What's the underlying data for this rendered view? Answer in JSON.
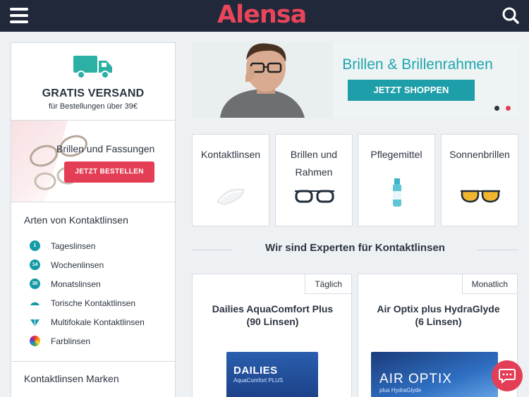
{
  "header": {
    "logo_text": "Alensa",
    "menu_icon": "hamburger-menu-icon",
    "search_icon": "search-icon",
    "bg_color": "#20283a",
    "logo_color": "#e8455a"
  },
  "sidebar": {
    "shipping": {
      "icon": "delivery-truck-icon",
      "title": "GRATIS VERSAND",
      "subtitle": "für Bestellungen über 39€"
    },
    "promo": {
      "title": "Brillen und Fassungen",
      "button_label": "JETZT BESTELLEN"
    },
    "types_title": "Arten von Kontaktlinsen",
    "types": [
      {
        "label": "Tageslinsen",
        "icon_text": "1"
      },
      {
        "label": "Wochenlinsen",
        "icon_text": "14"
      },
      {
        "label": "Monatslinsen",
        "icon_text": "30"
      },
      {
        "label": "Torische Kontaktlinsen",
        "icon_text": ""
      },
      {
        "label": "Multifokale Kontaktlinsen",
        "icon_text": ""
      },
      {
        "label": "Farblinsen",
        "icon_text": ""
      }
    ],
    "brands_title": "Kontaktlinsen Marken"
  },
  "banner": {
    "title": "Brillen & Brillenrahmen",
    "button_label": "JETZT SHOPPEN",
    "accent": "#1d9ea8"
  },
  "categories": [
    {
      "label": "Kontaktlinsen",
      "icon": "contact-lens-icon"
    },
    {
      "label": "Brillen und Rahmen",
      "icon": "eyeglasses-icon"
    },
    {
      "label": "Pflegemittel",
      "icon": "solution-bottle-icon"
    },
    {
      "label": "Sonnenbrillen",
      "icon": "sunglasses-icon"
    }
  ],
  "experts_title": "Wir sind Experten für Kontaktlinsen",
  "products": [
    {
      "badge": "Täglich",
      "name_line1": "Dailies AquaComfort Plus",
      "name_line2": "(90 Linsen)",
      "box_text": "DAILIES",
      "box_sub": "AquaComfort PLUS"
    },
    {
      "badge": "Monatlich",
      "name_line1": "Air Optix plus HydraGlyde",
      "name_line2": "(6 Linsen)",
      "box_text": "AIR OPTIX",
      "box_sub": "plus HydraGlyde"
    }
  ],
  "chat": {
    "icon": "chat-bubble-icon"
  }
}
